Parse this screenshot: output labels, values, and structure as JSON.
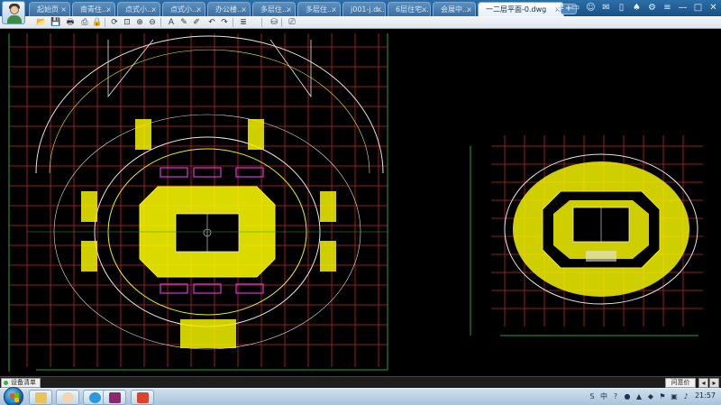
{
  "app": {
    "tabs": [
      {
        "label": "起始页",
        "active": false
      },
      {
        "label": "南青住...",
        "active": false
      },
      {
        "label": "点式小...",
        "active": false
      },
      {
        "label": "点式小...",
        "active": false
      },
      {
        "label": "办公楼...",
        "active": false
      },
      {
        "label": "多层住...",
        "active": false
      },
      {
        "label": "多层住...",
        "active": false
      },
      {
        "label": "j001-j.d...",
        "active": false
      },
      {
        "label": "6层住宅...",
        "active": false
      },
      {
        "label": "会展中...",
        "active": false
      },
      {
        "label": "一二层平面-0.dwg",
        "active": true
      }
    ],
    "add_tab_label": "+",
    "close_glyph": "×",
    "system_icons": [
      {
        "name": "sync-icon",
        "glyph": "⇄"
      },
      {
        "name": "screen-icon",
        "glyph": "▭"
      },
      {
        "name": "user-icon",
        "glyph": "☺"
      },
      {
        "name": "chat-icon",
        "glyph": "✉"
      },
      {
        "name": "phone-icon",
        "glyph": "▯"
      },
      {
        "name": "tshirt-icon",
        "glyph": "♠"
      },
      {
        "name": "gear-icon",
        "glyph": "⚙"
      },
      {
        "name": "menu-icon",
        "glyph": "≡"
      },
      {
        "name": "minimize-icon",
        "glyph": "—"
      },
      {
        "name": "maximize-icon",
        "glyph": "□"
      },
      {
        "name": "close-icon",
        "glyph": "✕"
      }
    ]
  },
  "toolbar": {
    "tools": [
      {
        "name": "open-button",
        "glyph": "📂"
      },
      {
        "name": "save-button",
        "glyph": "💾"
      },
      {
        "name": "print-button",
        "glyph": "🖶"
      },
      {
        "name": "export-pdf-button",
        "glyph": "⎙"
      },
      {
        "name": "lock-button",
        "glyph": "🔒"
      },
      {
        "name": "rotate-button",
        "glyph": "⟳"
      },
      {
        "name": "zoom-window-button",
        "glyph": "⊡"
      },
      {
        "name": "zoom-in-button",
        "glyph": "⊕"
      },
      {
        "name": "zoom-out-button",
        "glyph": "⊖"
      },
      {
        "name": "text-button",
        "glyph": "A"
      },
      {
        "name": "pencil-button",
        "glyph": "✎"
      },
      {
        "name": "brush-button",
        "glyph": "✐"
      },
      {
        "name": "undo-button",
        "glyph": "↶"
      },
      {
        "name": "redo-button",
        "glyph": "↷"
      },
      {
        "name": "layers-button",
        "glyph": "≣"
      },
      {
        "name": "stack-button",
        "glyph": "⛁"
      },
      {
        "name": "measure-button",
        "glyph": "⎚"
      }
    ]
  },
  "status": {
    "panel_label": "设备清单",
    "feedback_label": "问意价",
    "btn_a": "◂",
    "btn_b": "▸"
  },
  "taskbar": {
    "tray": [
      {
        "name": "sogou-icon",
        "glyph": "S"
      },
      {
        "name": "ime-icon",
        "glyph": "中"
      },
      {
        "name": "help-icon",
        "glyph": "?"
      },
      {
        "name": "qq-icon",
        "glyph": "●"
      },
      {
        "name": "network-icon",
        "glyph": "▲"
      },
      {
        "name": "shield-icon",
        "glyph": "◆"
      },
      {
        "name": "flag-icon",
        "glyph": "⚑"
      },
      {
        "name": "screen-tray-icon",
        "glyph": "▣"
      },
      {
        "name": "volume-icon",
        "glyph": "♪"
      }
    ],
    "clock": "21:57"
  },
  "colors": {
    "canvas_bg": "#000000",
    "grid_red": "#c0262a",
    "grid_green": "#2ea02e",
    "seats_yellow": "#f2f200",
    "walls_white": "#e6e6e6",
    "accent_magenta": "#d63ad6"
  }
}
